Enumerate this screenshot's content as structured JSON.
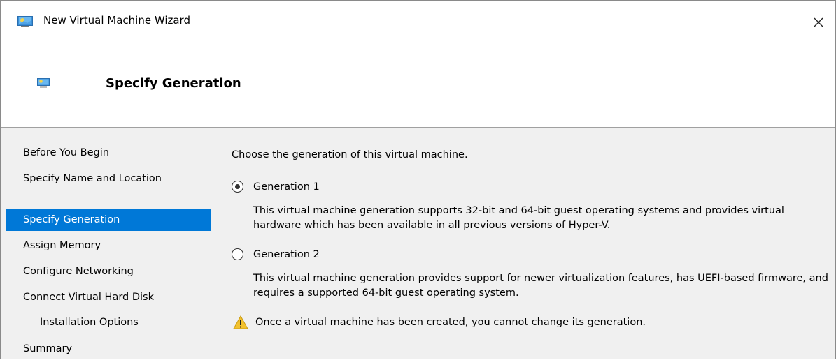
{
  "window": {
    "title": "New Virtual Machine Wizard",
    "app_icon": "hyper-v-vm-icon",
    "close_icon": "close-icon"
  },
  "header": {
    "title": "Specify Generation",
    "icon": "hyper-v-vm-icon"
  },
  "nav": {
    "items": [
      {
        "label": "Before You Begin",
        "selected": false,
        "indent": false
      },
      {
        "label": "Specify Name and Location",
        "selected": false,
        "indent": false
      },
      {
        "label": "Specify Generation",
        "selected": true,
        "indent": false
      },
      {
        "label": "Assign Memory",
        "selected": false,
        "indent": false
      },
      {
        "label": "Configure Networking",
        "selected": false,
        "indent": false
      },
      {
        "label": "Connect Virtual Hard Disk",
        "selected": false,
        "indent": false
      },
      {
        "label": "Installation Options",
        "selected": false,
        "indent": true
      },
      {
        "label": "Summary",
        "selected": false,
        "indent": false
      }
    ],
    "selected_color": "#0078d7"
  },
  "content": {
    "intro": "Choose the generation of this virtual machine.",
    "options": [
      {
        "label": "Generation 1",
        "checked": true,
        "description": "This virtual machine generation supports 32-bit and 64-bit guest operating systems and provides virtual hardware which has been available in all previous versions of Hyper-V."
      },
      {
        "label": "Generation 2",
        "checked": false,
        "description": "This virtual machine generation provides support for newer virtualization features, has UEFI-based firmware, and requires a supported 64-bit guest operating system."
      }
    ],
    "warning": {
      "icon": "warning-icon",
      "text": "Once a virtual machine has been created, you cannot change its generation."
    }
  }
}
